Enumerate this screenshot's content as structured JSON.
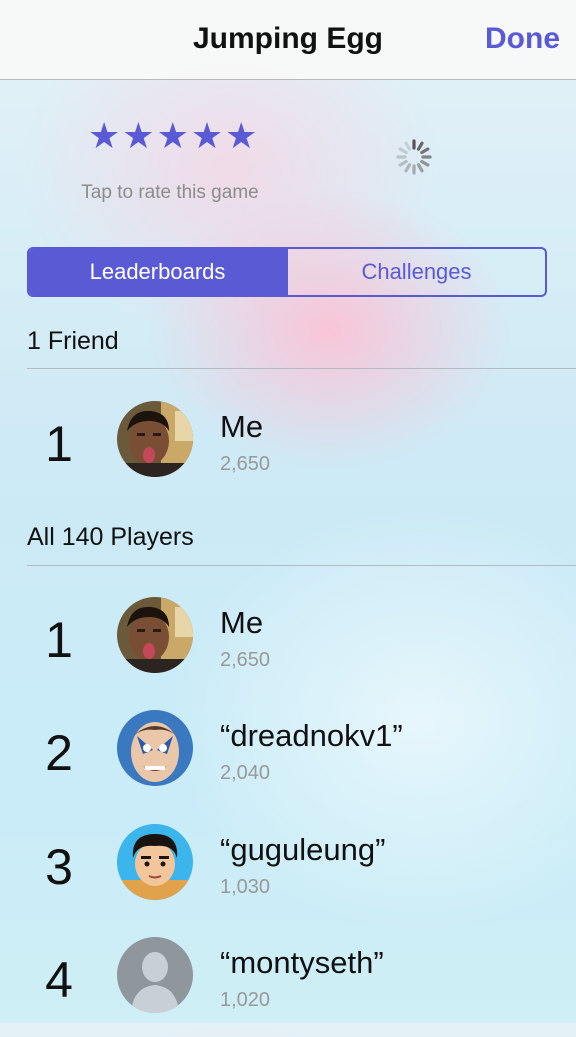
{
  "nav": {
    "title": "Jumping Egg",
    "done_label": "Done"
  },
  "rating": {
    "stars": 5,
    "hint": "Tap to rate this game"
  },
  "tabs": [
    {
      "label": "Leaderboards",
      "selected": true
    },
    {
      "label": "Challenges",
      "selected": false
    }
  ],
  "friends_section": {
    "header": "1 Friend",
    "rows": [
      {
        "rank": "1",
        "name": "Me",
        "score": "2,650",
        "avatar": "photo-avatar"
      }
    ]
  },
  "all_section": {
    "header": "All 140 Players",
    "rows": [
      {
        "rank": "1",
        "name": "Me",
        "score": "2,650",
        "avatar": "photo-avatar"
      },
      {
        "rank": "2",
        "name": "“dreadnokv1”",
        "score": "2,040",
        "avatar": "caricature-avatar"
      },
      {
        "rank": "3",
        "name": "“guguleung”",
        "score": "1,030",
        "avatar": "cartoon-avatar"
      },
      {
        "rank": "4",
        "name": "“montyseth”",
        "score": "1,020",
        "avatar": "default-person-avatar"
      }
    ]
  },
  "colors": {
    "accent": "#5a5bd4",
    "secondary_text": "#999999"
  }
}
